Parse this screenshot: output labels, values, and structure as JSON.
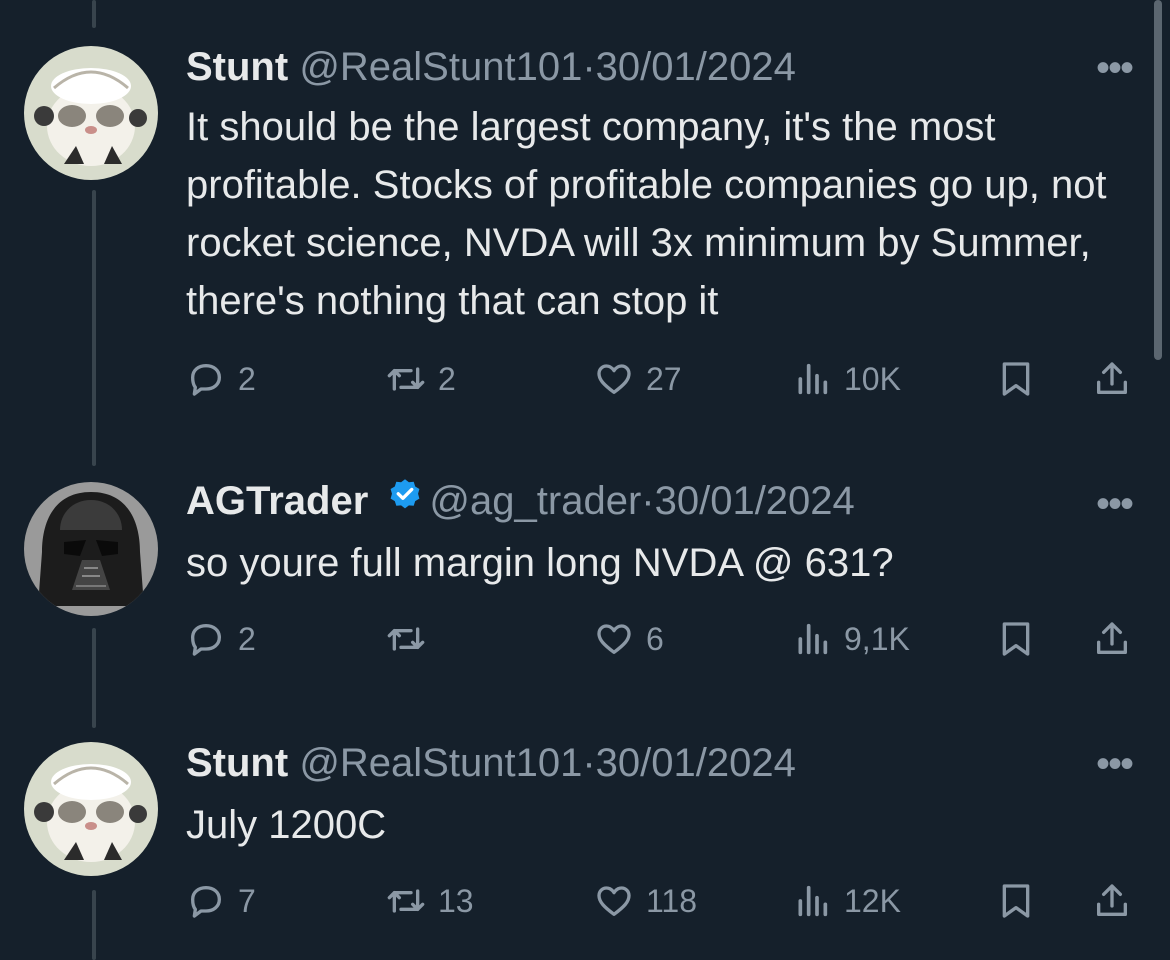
{
  "tweets": [
    {
      "name": "Stunt",
      "handle": "@RealStunt101",
      "separator": "·",
      "date": "30/01/2024",
      "text": "It should be the largest company, it's the most profitable. Stocks of profitable companies go up, not rocket science, NVDA will 3x minimum by Summer, there's nothing that can stop it",
      "replies": "2",
      "reposts": "2",
      "likes": "27",
      "views": "10K",
      "avatar_icon": "cat-avatar"
    },
    {
      "name": "AGTrader",
      "handle": "@ag_trader",
      "separator": "·",
      "date": "30/01/2024",
      "text": "so youre full margin long NVDA @  631?",
      "replies": "2",
      "reposts": "",
      "likes": "6",
      "views": "9,1K",
      "verified": true,
      "avatar_icon": "darth-vader-avatar"
    },
    {
      "name": "Stunt",
      "handle": "@RealStunt101",
      "separator": "·",
      "date": "30/01/2024",
      "text": "July 1200C",
      "replies": "7",
      "reposts": "13",
      "likes": "118",
      "views": "12K",
      "avatar_icon": "cat-avatar"
    }
  ],
  "more_label": "•••",
  "colors": {
    "background": "#15202b",
    "text_primary": "#e7e9ea",
    "text_secondary": "#8b98a5",
    "verified": "#1d9bf0",
    "thread_line": "#38444d"
  }
}
